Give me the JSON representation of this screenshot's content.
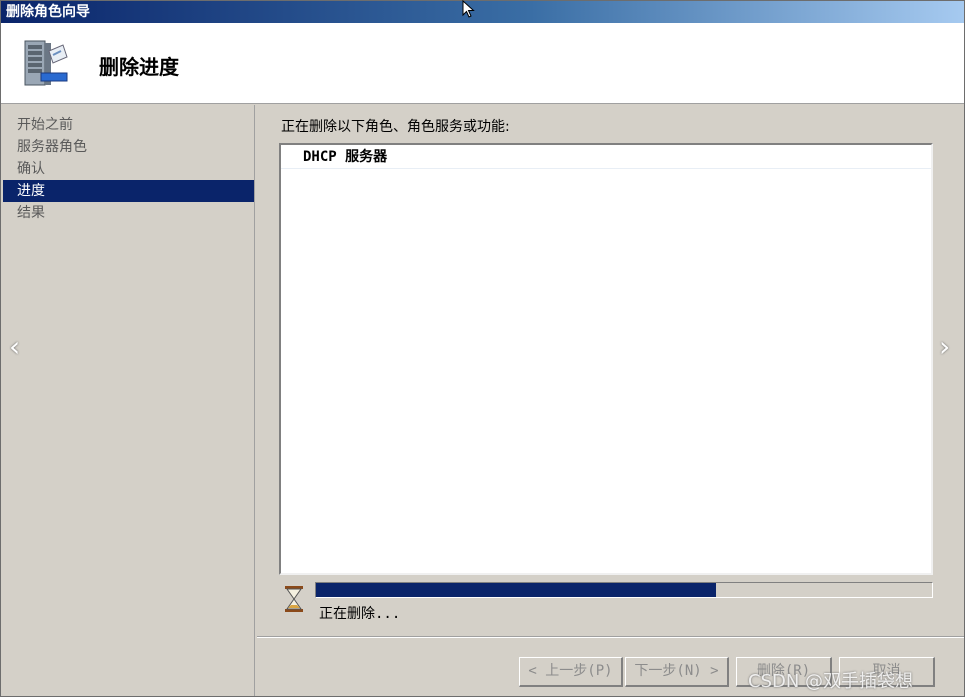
{
  "window": {
    "title": "删除角色向导"
  },
  "header": {
    "title": "删除进度",
    "icon": "server-icon"
  },
  "sidebar": {
    "items": [
      {
        "label": "开始之前",
        "active": false
      },
      {
        "label": "服务器角色",
        "active": false
      },
      {
        "label": "确认",
        "active": false
      },
      {
        "label": "进度",
        "active": true
      },
      {
        "label": "结果",
        "active": false
      }
    ]
  },
  "main": {
    "label": "正在删除以下角色、角色服务或功能:",
    "list": [
      "DHCP 服务器"
    ],
    "progress": {
      "percent": 65,
      "status_text": "正在删除..."
    }
  },
  "buttons": {
    "prev": "< 上一步(P)",
    "next": "下一步(N) >",
    "delete": "删除(R)",
    "cancel": "取消"
  },
  "watermark": "CSDN @双手插袋想",
  "colors": {
    "accent": "#0a246a",
    "title_gradient_end": "#a6caf0",
    "background": "#d4d0c8"
  }
}
